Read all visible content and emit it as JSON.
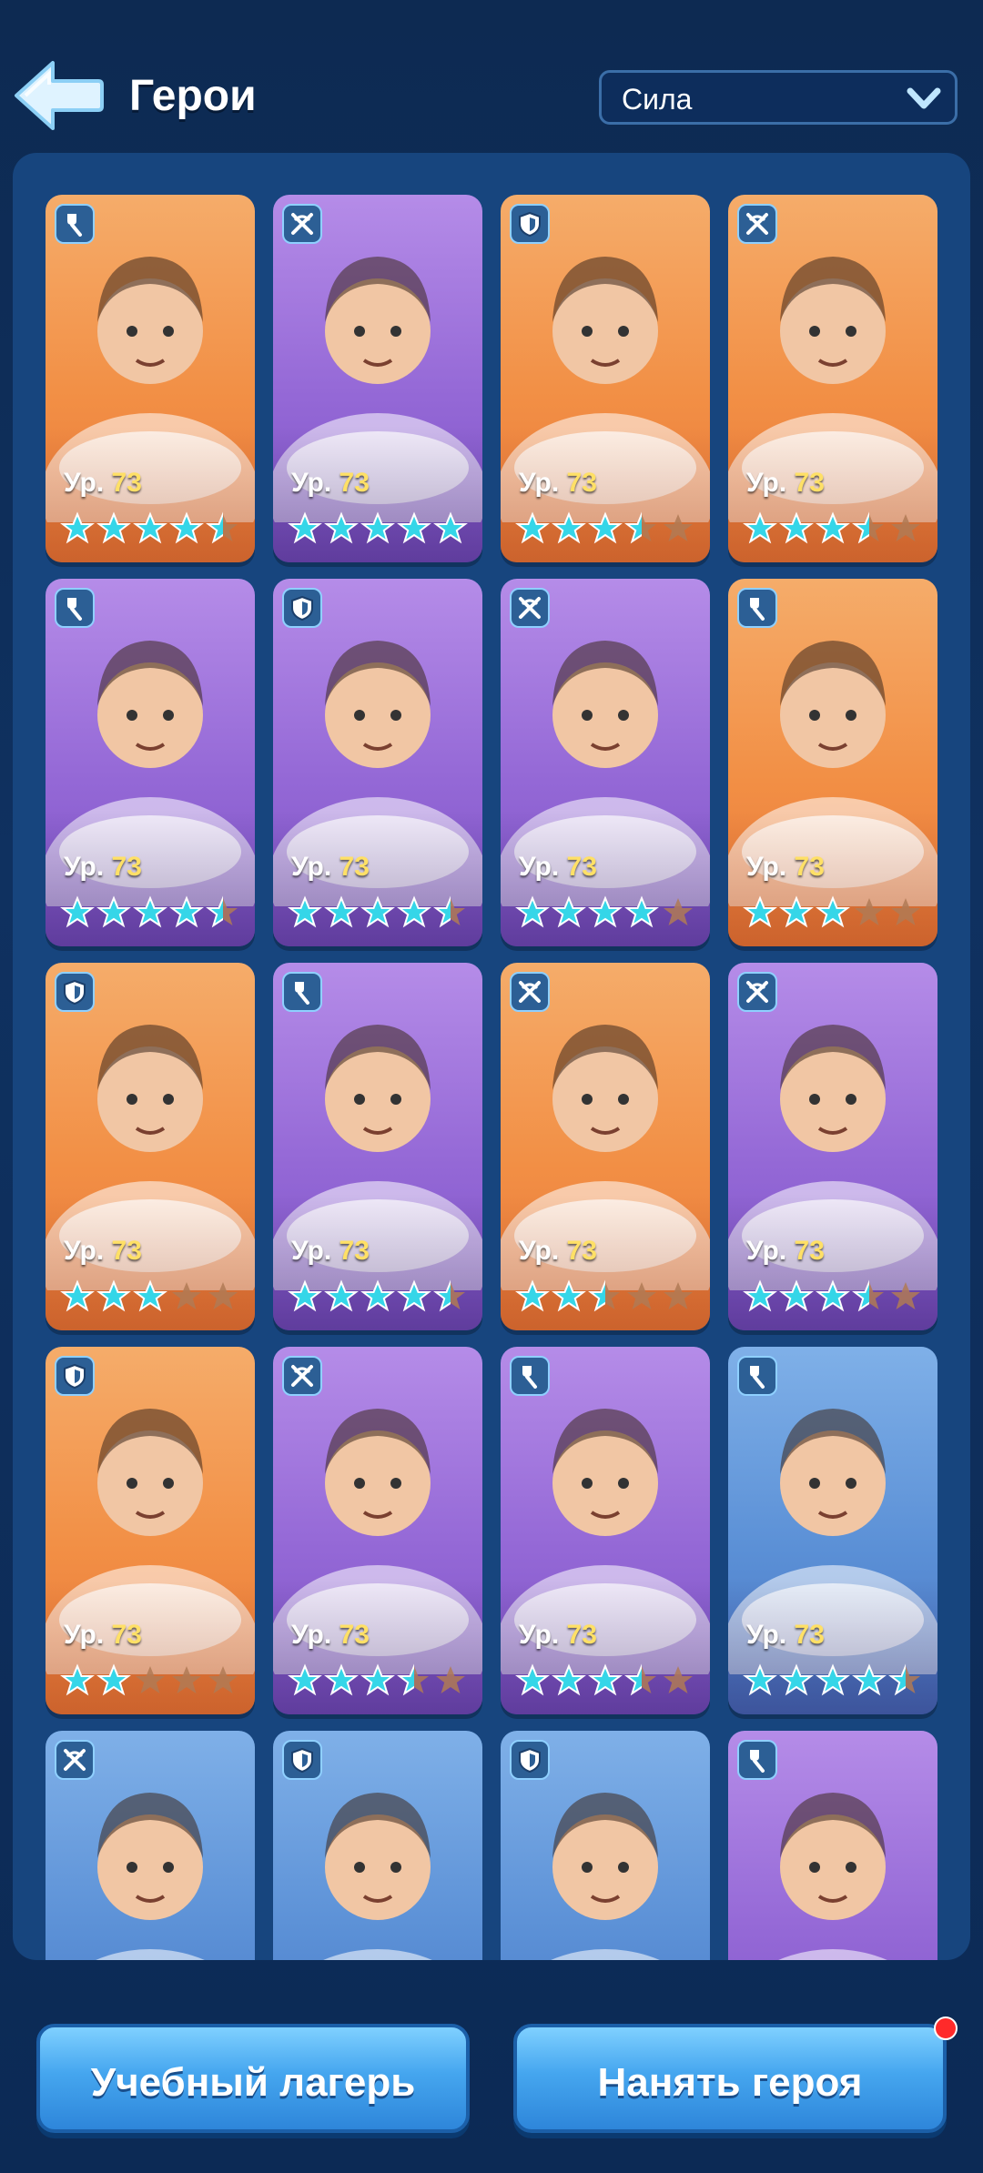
{
  "header": {
    "title": "Герои",
    "sort_value": "Сила"
  },
  "colors": {
    "orange_card": "#f28f45",
    "purple_card": "#9468d6",
    "blue_card": "#5b90d6",
    "star_filled": "#35d6e8",
    "star_empty": "#b07a55",
    "level_number": "#ffe066"
  },
  "level_prefix": "Ур.",
  "heroes": [
    {
      "bg": "orange",
      "role": "shovel-icon",
      "level": "73",
      "stars": 4.5
    },
    {
      "bg": "purple",
      "role": "crossbow-icon",
      "level": "73",
      "stars": 5
    },
    {
      "bg": "orange",
      "role": "shield-icon",
      "level": "73",
      "stars": 3.5
    },
    {
      "bg": "orange",
      "role": "crossbow-icon",
      "level": "73",
      "stars": 3.5
    },
    {
      "bg": "purple",
      "role": "shovel-icon",
      "level": "73",
      "stars": 4.5
    },
    {
      "bg": "purple",
      "role": "shield-icon",
      "level": "73",
      "stars": 4.5
    },
    {
      "bg": "purple",
      "role": "crossbow-icon",
      "level": "73",
      "stars": 4
    },
    {
      "bg": "orange",
      "role": "shovel-icon",
      "level": "73",
      "stars": 3
    },
    {
      "bg": "orange",
      "role": "shield-icon",
      "level": "73",
      "stars": 3
    },
    {
      "bg": "purple",
      "role": "shovel-icon",
      "level": "73",
      "stars": 4.5
    },
    {
      "bg": "orange",
      "role": "crossbow-icon",
      "level": "73",
      "stars": 2.5
    },
    {
      "bg": "purple",
      "role": "crossbow-icon",
      "level": "73",
      "stars": 3.5
    },
    {
      "bg": "orange",
      "role": "shield-icon",
      "level": "73",
      "stars": 2
    },
    {
      "bg": "purple",
      "role": "crossbow-icon",
      "level": "73",
      "stars": 3.5
    },
    {
      "bg": "purple",
      "role": "shovel-icon",
      "level": "73",
      "stars": 3.5
    },
    {
      "bg": "blue",
      "role": "shovel-icon",
      "level": "73",
      "stars": 4.5
    },
    {
      "bg": "blue",
      "role": "crossbow-icon",
      "level": "",
      "stars": 0
    },
    {
      "bg": "blue",
      "role": "shield-icon",
      "level": "",
      "stars": 0
    },
    {
      "bg": "blue",
      "role": "shield-icon",
      "level": "",
      "stars": 0
    },
    {
      "bg": "purple",
      "role": "shovel-icon",
      "level": "",
      "stars": 0
    }
  ],
  "buttons": {
    "training_camp": "Учебный лагерь",
    "hire_hero": "Нанять героя"
  }
}
